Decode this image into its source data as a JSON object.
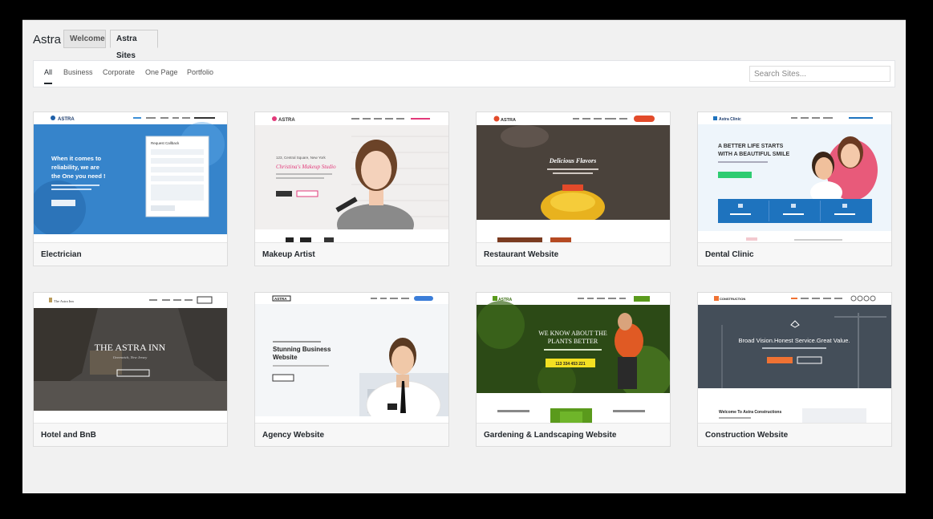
{
  "app": {
    "title": "Astra"
  },
  "tabs": {
    "welcome": "Welcome",
    "astra_sites": "Astra Sites"
  },
  "filters": [
    "All",
    "Business",
    "Corporate",
    "One Page",
    "Portfolio"
  ],
  "search": {
    "placeholder": "Search Sites..."
  },
  "sites": [
    {
      "name": "Electrician",
      "preview": {
        "logo": "ASTRA",
        "headline": [
          "When it comes to",
          "reliability, we are",
          "the One you need !"
        ],
        "form_title": "Request Callback"
      }
    },
    {
      "name": "Makeup Artist",
      "preview": {
        "logo": "ASTRA",
        "address": "123, Central Square, New York",
        "headline": "Christina's Makeup Studio"
      }
    },
    {
      "name": "Restaurant Website",
      "preview": {
        "logo": "ASTRA",
        "headline": "Delicious Flavors"
      }
    },
    {
      "name": "Dental Clinic",
      "preview": {
        "logo": "Astra Clinic",
        "headline": [
          "A BETTER LIFE STARTS",
          "WITH A BEAUTIFUL SMILE"
        ]
      }
    },
    {
      "name": "Hotel and BnB",
      "preview": {
        "logo": "The Astra Inn",
        "headline": "THE ASTRA INN",
        "subline": "Greenwich, New Jersey"
      }
    },
    {
      "name": "Agency Website",
      "preview": {
        "logo": "ASTRA",
        "headline": [
          "Stunning Business",
          "Website"
        ]
      }
    },
    {
      "name": "Gardening & Landscaping Website",
      "preview": {
        "logo": "ASTRA",
        "headline": [
          "WE KNOW ABOUT THE",
          "PLANTS BETTER"
        ],
        "phone": "113 334 453 221"
      }
    },
    {
      "name": "Construction Website",
      "preview": {
        "logo": "CONSTRUCTION",
        "headline": "Broad Vision.Honest Service.Great Value.",
        "welcome": "Welcome To Astra Constructions"
      }
    }
  ],
  "colors": {
    "window_bg": "#f1f1f1",
    "electrician_blue": "#3d8fd6",
    "dental_blue": "#1e73be",
    "garden_green": "#5a9a1c",
    "accent_orange": "#f07233"
  }
}
